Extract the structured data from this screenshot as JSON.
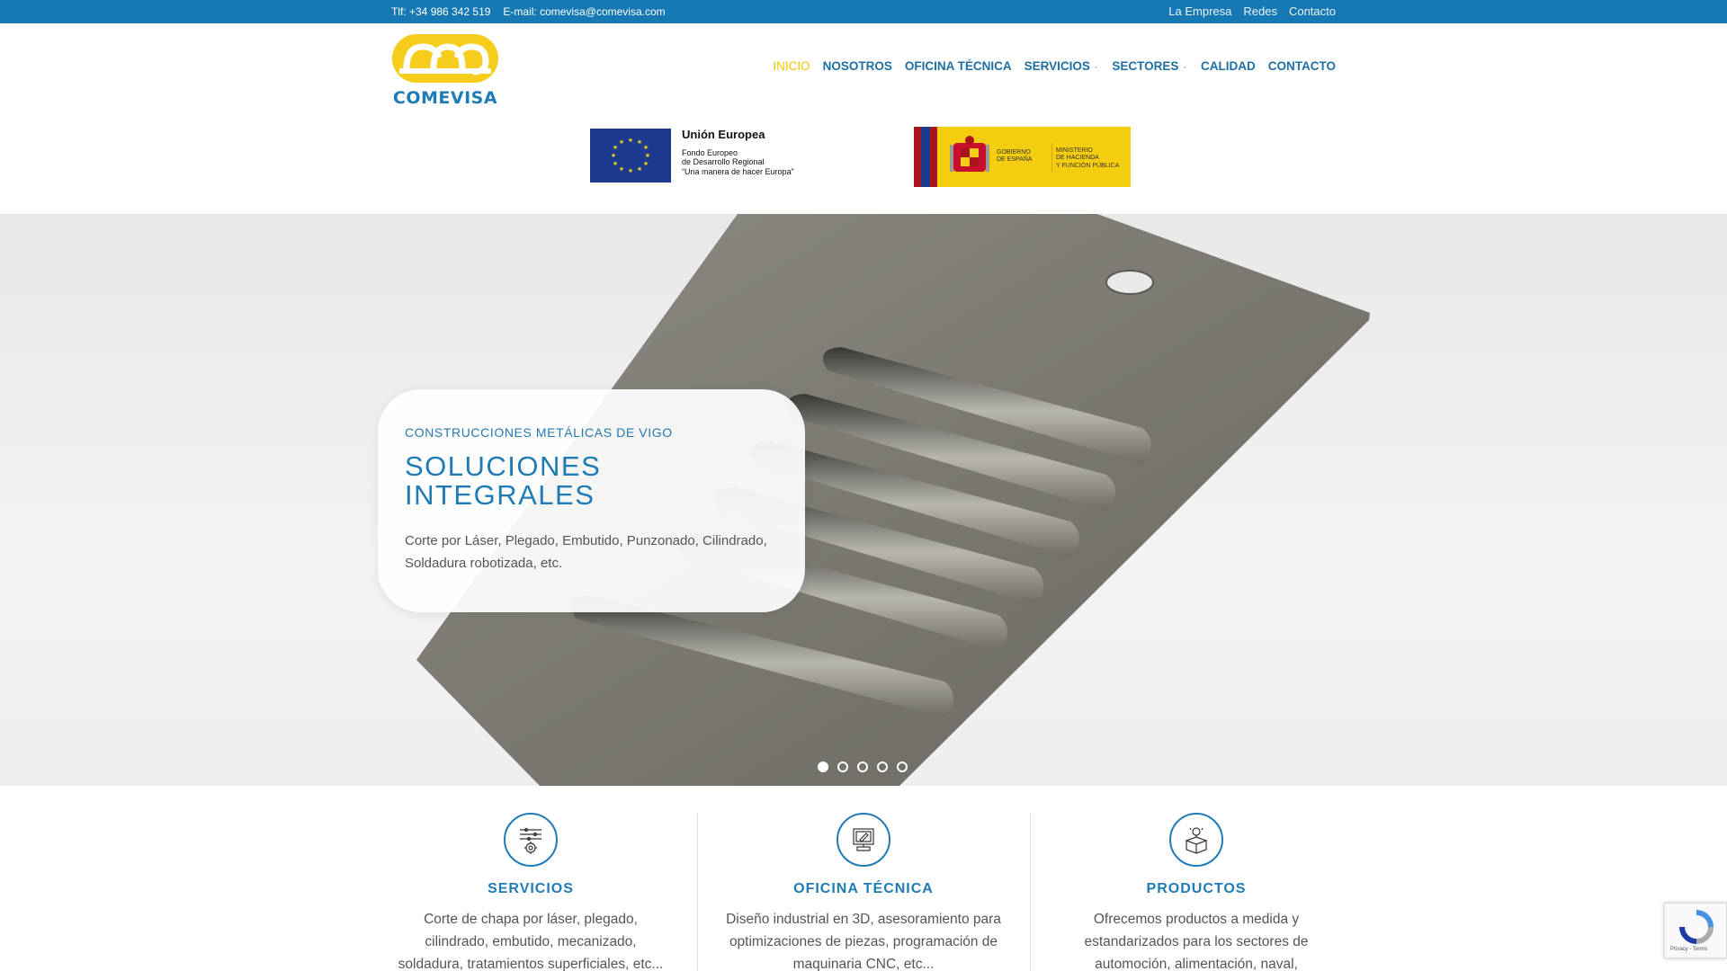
{
  "topbar": {
    "phone": "Tlf: +34 986 342 519",
    "email": "E-mail: comevisa@comevisa.com",
    "links": [
      "La Empresa",
      "Redes",
      "Contacto"
    ]
  },
  "logo": {
    "text": "COMEVISA"
  },
  "nav": {
    "items": [
      {
        "label": "INICIO"
      },
      {
        "label": "NOSOTROS"
      },
      {
        "label": "OFICINA TÉCNICA"
      },
      {
        "label": "SERVICIOS"
      },
      {
        "label": "SECTORES"
      },
      {
        "label": "CALIDAD"
      },
      {
        "label": "CONTACTO"
      }
    ]
  },
  "funding": {
    "eu_title": "Unión Europea",
    "eu_line1": "Fondo Europeo",
    "eu_line2": "de Desarrollo Regional",
    "eu_line3": "“Una manera de hacer Europa”",
    "gov_line1": "GOBIERNO",
    "gov_line2": "DE ESPAÑA",
    "min_line1": "MINISTERIO",
    "min_line2": "DE HACIENDA",
    "min_line3": "Y FUNCIÓN PÚBLICA"
  },
  "hero": {
    "kicker": "CONSTRUCCIONES METÁLICAS DE VIGO",
    "title_line1": "SOLUCIONES",
    "title_line2": "INTEGRALES",
    "desc_line1": "Corte por Láser, Plegado, Embutido, Punzonado, Cilindrado,",
    "desc_line2": "Soldadura robotizada, etc.",
    "slide_count": 5,
    "active_slide": 1
  },
  "features": [
    {
      "icon": "gear-settings-icon",
      "title": "SERVICIOS",
      "line1": "Corte de chapa por láser, plegado,",
      "line2": "cilindrado, embutido, mecanizado,",
      "line3": "soldadura, tratamientos superficiales, etc..."
    },
    {
      "icon": "computer-design-icon",
      "title": "OFICINA TÉCNICA",
      "line1": "Diseño industrial en 3D, asesoramiento para",
      "line2": "optimizaciones de piezas, programación de",
      "line3": "maquinaria CNC, etc..."
    },
    {
      "icon": "product-box-icon",
      "title": "PRODUCTOS",
      "line1": "Ofrecemos productos a medida y",
      "line2": "estandarizados para los sectores de",
      "line3": "automoción, alimentación, naval,"
    }
  ],
  "recaptcha": {
    "text": "Privacy - Terms"
  },
  "colors": {
    "primary": "#1f7bb6",
    "topbar": "#1779b3",
    "accent": "#f1c400"
  }
}
